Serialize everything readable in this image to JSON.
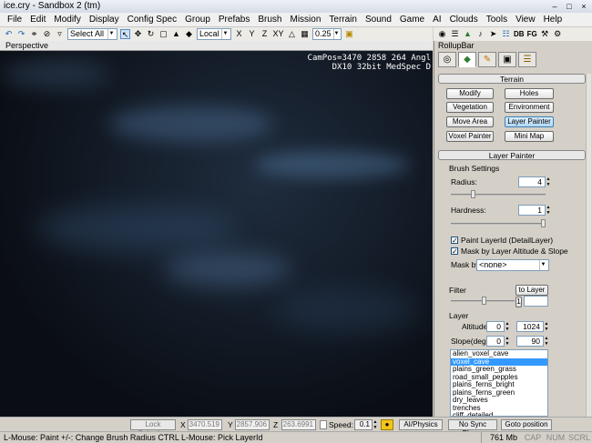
{
  "window": {
    "title": "ice.cry - Sandbox 2 (tm)"
  },
  "menu": [
    "File",
    "Edit",
    "Modify",
    "Display",
    "Config Spec",
    "Group",
    "Prefabs",
    "Brush",
    "Mission",
    "Terrain",
    "Sound",
    "Game",
    "AI",
    "Clouds",
    "Tools",
    "View",
    "Help"
  ],
  "toolbar": {
    "select_mode": "Select All",
    "coord_space": "Local",
    "axes": [
      "X",
      "Y",
      "Z",
      "XY"
    ],
    "grid_size": "0.25",
    "right_icons": [
      "DB",
      "FG"
    ]
  },
  "viewport": {
    "title": "Perspective",
    "hud_line1": "CamPos=3470 2858 264 Angl",
    "hud_line2": "DX10 32bit MedSpec D"
  },
  "rollup": {
    "title": "RollupBar",
    "terrain_section": "Terrain",
    "terrain_buttons": [
      "Modify",
      "Holes",
      "Vegetation",
      "Environment",
      "Move Area",
      "Layer Painter",
      "Voxel Painter",
      "Mini Map"
    ],
    "layer_painter_section": "Layer Painter",
    "brush_settings": "Brush Settings",
    "radius_label": "Radius:",
    "radius_value": "4",
    "hardness_label": "Hardness:",
    "hardness_value": "1",
    "paint_layerid_label": "Paint LayerId (DetailLayer)",
    "mask_altitude_label": "Mask by Layer Altitude & Slope",
    "mask_by_label": "Mask by",
    "mask_by_value": "<none>",
    "filter_label": "Filter",
    "to_layer_button": "to Layer",
    "filter_one": "1",
    "layer_label": "Layer",
    "altitude_label": "Altitude",
    "altitude_min": "0",
    "altitude_max": "1024",
    "slope_label": "Slope(deg.)",
    "slope_min": "0",
    "slope_max": "90",
    "layers": [
      "alien_voxel_cave",
      "voxel_cave",
      "plains_green_grass",
      "road_small_pepples",
      "plains_ferns_bright",
      "plains_ferns_green",
      "dry_leaves",
      "trenches",
      "cliff_detailed"
    ],
    "selected_layer": "voxel_cave"
  },
  "statusbar": {
    "lock_selection": "Lock Selection",
    "x_label": "X",
    "x_value": "3470.519",
    "y_label": "Y",
    "y_value": "2857.906",
    "z_label": "Z",
    "z_value": "263.6991",
    "speed_label": "Speed:",
    "speed_value": "0.1",
    "ai_physics": "AI/Physics",
    "no_sync_player": "No Sync Player",
    "goto_position": "Goto position"
  },
  "statusbar2": {
    "hint": "L-Mouse: Paint  +/-: Change Brush Radius   CTRL L-Mouse: Pick LayerId",
    "memory": "761 Mb",
    "indicators": [
      "CAP",
      "NUM",
      "SCRL"
    ]
  }
}
